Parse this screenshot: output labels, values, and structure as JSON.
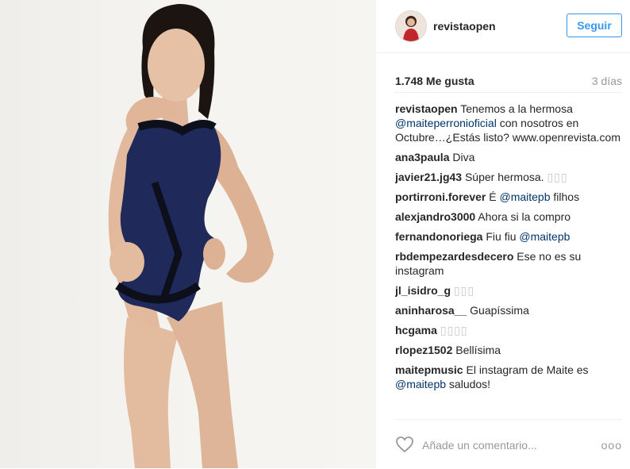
{
  "post": {
    "username": "revistaopen",
    "follow_label": "Seguir",
    "likes": "1.748 Me gusta",
    "time_ago": "3 días",
    "caption": {
      "user": "revistaopen",
      "text_1": "Tenemos a la hermosa",
      "mention": "@maiteperronioficial",
      "text_2": "con nosotros en Octubre…¿Estás listo? www.openrevista.com"
    },
    "comments": [
      {
        "user": "ana3paula",
        "text": "Diva"
      },
      {
        "user": "javier21.jg43",
        "text": "Súper hermosa.",
        "squares": "▯▯▯"
      },
      {
        "user": "portirroni.forever",
        "text": "É",
        "mention": "@maitepb",
        "after": "filhos"
      },
      {
        "user": "alexjandro3000",
        "text": "Ahora si la compro"
      },
      {
        "user": "fernandonoriega",
        "text": "Fiu fiu",
        "mention": "@maitepb"
      },
      {
        "user": "rbdempezardesdecero",
        "text": "Ese no es su instagram"
      },
      {
        "user": "jl_isidro_g",
        "squares": "▯▯▯"
      },
      {
        "user": "aninharosa__",
        "text": "Guapíssima"
      },
      {
        "user": "hcgama",
        "squares": "▯▯▯▯"
      },
      {
        "user": "rlopez1502",
        "text": "Bellísima"
      },
      {
        "user": "maitepmusic",
        "text": "El instagram de Maite es",
        "mention": "@maitepb",
        "after": "saludos!"
      }
    ],
    "add_comment_placeholder": "Añade un comentario...",
    "more_label": "ooo"
  },
  "icons": {
    "like": "heart-outline-icon",
    "more": "ellipsis-icon"
  },
  "colors": {
    "accent": "#3897f0",
    "mention": "#003569",
    "muted": "#999999",
    "swimsuit": "#1f2a5a"
  }
}
